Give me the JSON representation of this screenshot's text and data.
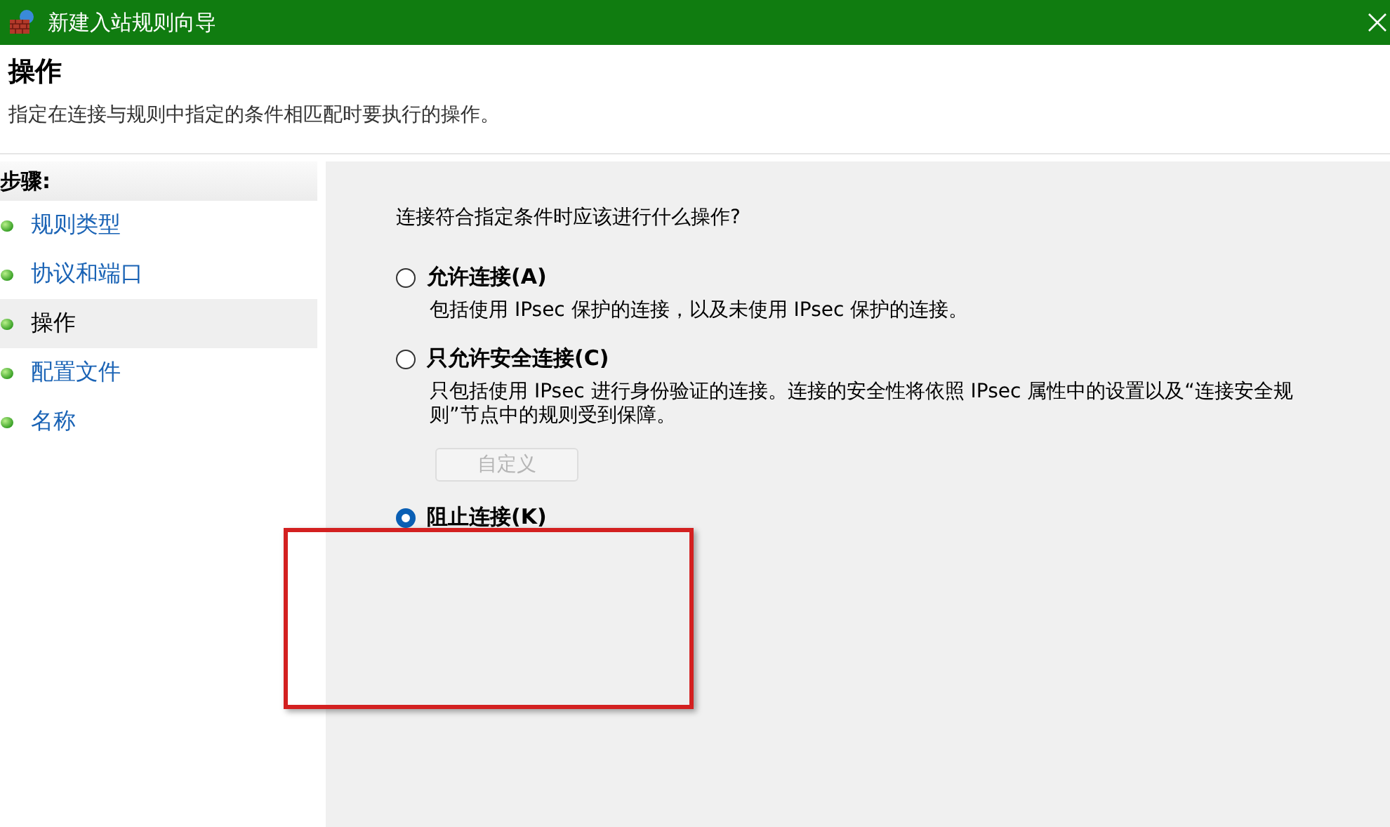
{
  "window": {
    "title": "新建入站规则向导"
  },
  "header": {
    "title": "操作",
    "description": "指定在连接与规则中指定的条件相匹配时要执行的操作。"
  },
  "steps": {
    "heading": "步骤:",
    "items": [
      {
        "label": "规则类型",
        "selected": false
      },
      {
        "label": "协议和端口",
        "selected": false
      },
      {
        "label": "操作",
        "selected": true
      },
      {
        "label": "配置文件",
        "selected": false
      },
      {
        "label": "名称",
        "selected": false
      }
    ]
  },
  "question": "连接符合指定条件时应该进行什么操作?",
  "options": [
    {
      "label": "允许连接(A)",
      "description": "包括使用 IPsec 保护的连接，以及未使用 IPsec 保护的连接。",
      "selected": false
    },
    {
      "label": "只允许安全连接(C)",
      "description": "只包括使用 IPsec 进行身份验证的连接。连接的安全性将依照 IPsec 属性中的设置以及“连接安全规则”节点中的规则受到保障。",
      "selected": false,
      "button": {
        "label": "自定义",
        "disabled": true
      }
    },
    {
      "label": "阻止连接(K)",
      "selected": true
    }
  ]
}
